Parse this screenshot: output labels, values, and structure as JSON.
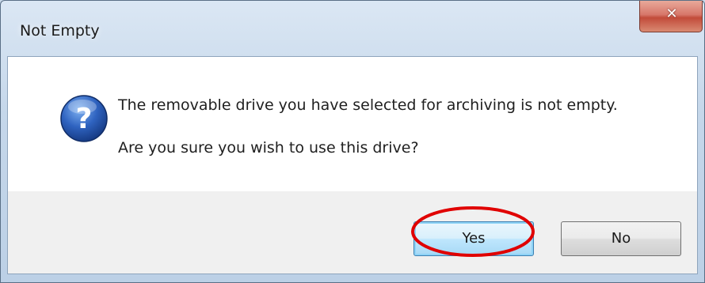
{
  "dialog": {
    "title": "Not Empty",
    "close_icon": "close-icon",
    "message_icon": "question-icon",
    "message_lines": [
      "The removable drive you have selected for archiving is not empty.",
      "Are you sure you wish to use this drive?"
    ],
    "buttons": {
      "yes_label": "Yes",
      "no_label": "No"
    }
  },
  "colors": {
    "close_button": "#c24b3a",
    "highlight_ring": "#e00000",
    "default_button_border": "#3c7fb1",
    "question_icon": "#1f4fa8"
  }
}
